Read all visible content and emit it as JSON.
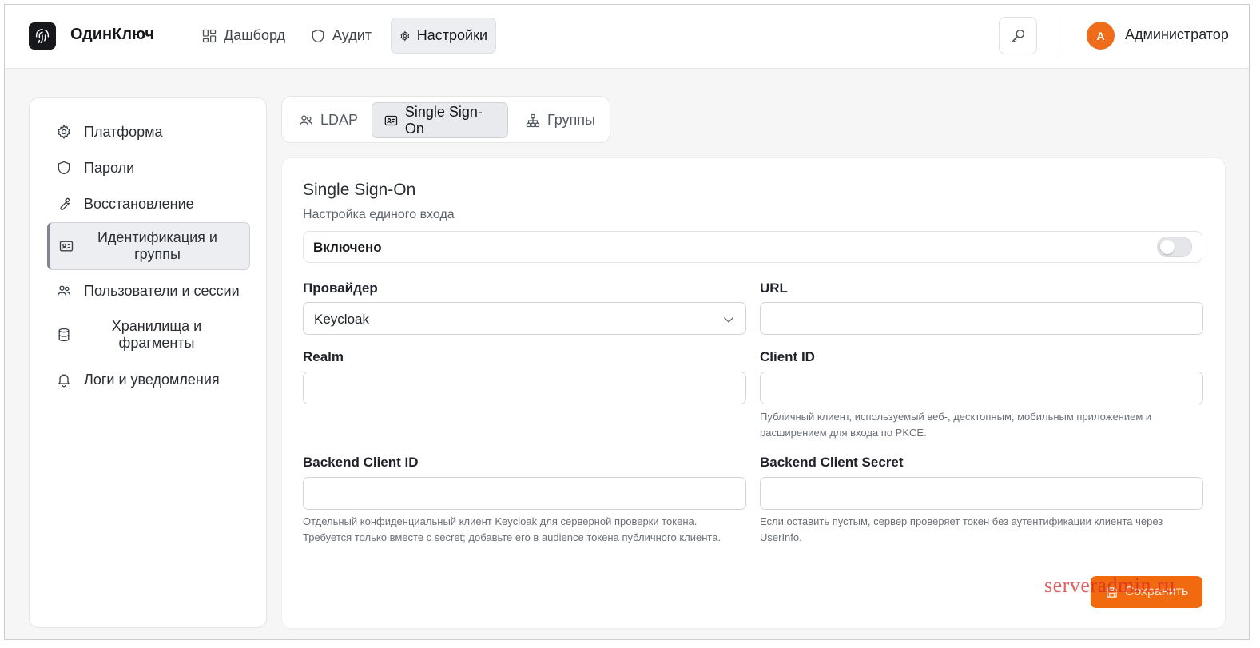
{
  "header": {
    "app_title": "ОдинКлюч",
    "nav": [
      {
        "label": "Дашборд",
        "icon": "dashboard-icon"
      },
      {
        "label": "Аудит",
        "icon": "shield-icon"
      },
      {
        "label": "Настройки",
        "icon": "gear-icon"
      }
    ],
    "active_nav": "Настройки",
    "user": {
      "initial": "A",
      "name": "Администратор"
    }
  },
  "sidebar": {
    "items": [
      {
        "label": "Платформа",
        "icon": "gear-icon"
      },
      {
        "label": "Пароли",
        "icon": "shield-icon"
      },
      {
        "label": "Восстановление",
        "icon": "wrench-icon"
      },
      {
        "label": "Идентификация и группы",
        "icon": "id-card-icon"
      },
      {
        "label": "Пользователи и сессии",
        "icon": "users-icon"
      },
      {
        "label": "Хранилища и фрагменты",
        "icon": "database-icon"
      },
      {
        "label": "Логи и уведомления",
        "icon": "bell-icon"
      }
    ],
    "active": "Идентификация и группы"
  },
  "tabs": {
    "items": [
      {
        "label": "LDAP",
        "icon": "users-icon"
      },
      {
        "label": "Single Sign-On",
        "icon": "id-card-icon"
      },
      {
        "label": "Группы",
        "icon": "hierarchy-icon"
      }
    ],
    "active": "Single Sign-On"
  },
  "form": {
    "title": "Single Sign-On",
    "subtitle": "Настройка единого входа",
    "enabled_label": "Включено",
    "enabled": false,
    "provider_label": "Провайдер",
    "provider_value": "Keycloak",
    "url_label": "URL",
    "url_value": "",
    "realm_label": "Realm",
    "realm_value": "",
    "client_id_label": "Client ID",
    "client_id_value": "",
    "client_id_help": "Публичный клиент, используемый веб-, десктопным, мобильным приложением и расширением для входа по PKCE.",
    "backend_client_id_label": "Backend Client ID",
    "backend_client_id_value": "",
    "backend_client_id_help": "Отдельный конфиденциальный клиент Keycloak для серверной проверки токена. Требуется только вместе с secret; добавьте его в audience токена публичного клиента.",
    "backend_secret_label": "Backend Client Secret",
    "backend_secret_value": "",
    "backend_secret_help": "Если оставить пустым, сервер проверяет токен без аутентификации клиента через UserInfo.",
    "save_label": "Сохранить"
  },
  "watermark": "serveradmin.ru",
  "colors": {
    "accent": "#f26a10",
    "avatar": "#ef6c1a"
  }
}
